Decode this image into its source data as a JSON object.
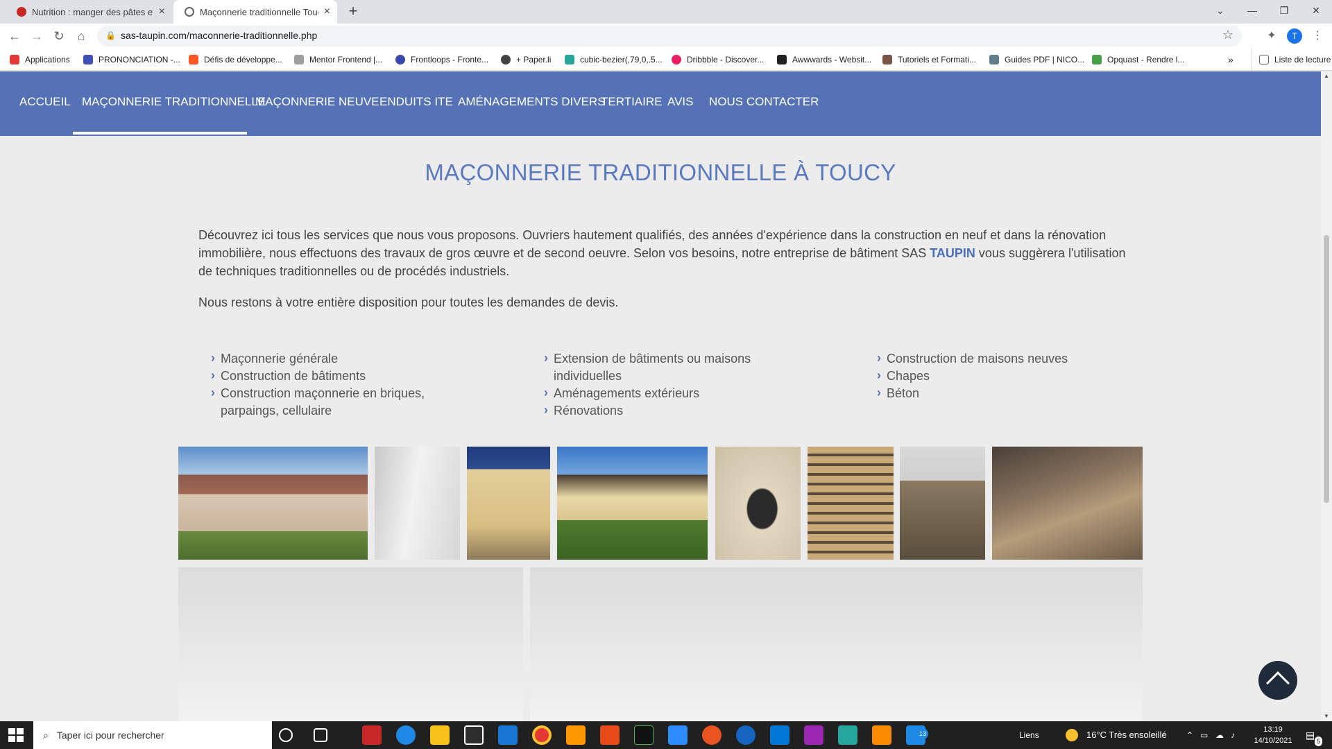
{
  "browser": {
    "tabs": [
      {
        "title": "Nutrition : manger des pâtes et c",
        "favicon_color": "#c62828"
      },
      {
        "title": "Maçonnerie traditionnelle Toucy",
        "favicon_color": "#5f6368"
      }
    ],
    "url": "sas-taupin.com/maconnerie-traditionnelle.php",
    "profile_initial": "T",
    "bookmarks": [
      {
        "label": "Applications",
        "color": "#e53935"
      },
      {
        "label": "PRONONCIATION -...",
        "color": "#3f51b5"
      },
      {
        "label": "Défis de développe...",
        "color": "#ff5722"
      },
      {
        "label": "Mentor Frontend |...",
        "color": "#9e9e9e"
      },
      {
        "label": "Frontloops - Fronte...",
        "color": "#3949ab"
      },
      {
        "label": "+ Paper.li",
        "color": "#424242"
      },
      {
        "label": "cubic-bezier(,79,0,.5...",
        "color": "#26a69a"
      },
      {
        "label": "Dribbble - Discover...",
        "color": "#e91e63"
      },
      {
        "label": "Awwwards - Websit...",
        "color": "#212121"
      },
      {
        "label": "Tutoriels et Formati...",
        "color": "#795548"
      },
      {
        "label": "Guides PDF | NICO...",
        "color": "#607d8b"
      },
      {
        "label": "Opquast - Rendre l...",
        "color": "#43a047"
      }
    ],
    "more_bookmarks": "»",
    "reading_list": "Liste de lecture"
  },
  "site": {
    "nav": [
      "ACCUEIL",
      "MAÇONNERIE TRADITIONNELLE",
      "MAÇONNERIE NEUVE",
      "ENDUITS ITE",
      "AMÉNAGEMENTS DIVERS",
      "TERTIAIRE",
      "AVIS",
      "NOUS CONTACTER"
    ],
    "active_nav": "MAÇONNERIE TRADITIONNELLE",
    "heading": "MAÇONNERIE TRADITIONNELLE À TOUCY",
    "intro_part1": "Découvrez ici tous les services que nous vous proposons. Ouvriers hautement qualifiés, des années d'expérience dans la construction en neuf et dans la rénovation immobilière, nous effectuons des travaux de gros œuvre et de second oeuvre. Selon vos besoins, notre entreprise de bâtiment SAS ",
    "intro_highlight": "TAUPIN",
    "intro_part2": " vous suggèrera l'utilisation de techniques traditionnelles ou de procédés industriels.",
    "intro2": "Nous restons à votre entière disposition pour toutes les demandes de devis.",
    "services_col1": [
      "Maçonnerie générale",
      "Construction de bâtiments",
      "Construction maçonnerie en briques, parpaings, cellulaire"
    ],
    "services_col2": [
      "Extension de bâtiments ou maisons individuelles",
      "Aménagements extérieurs",
      "Rénovations"
    ],
    "services_col3": [
      "Construction de maisons neuves",
      "Chapes",
      "Béton"
    ]
  },
  "taskbar": {
    "search_placeholder": "Taper ici pour rechercher",
    "links_label": "Liens",
    "weather": "16°C  Très ensoleillé",
    "time": "13:19",
    "date": "14/10/2021",
    "notification_count": "5",
    "app_badge": "13"
  }
}
